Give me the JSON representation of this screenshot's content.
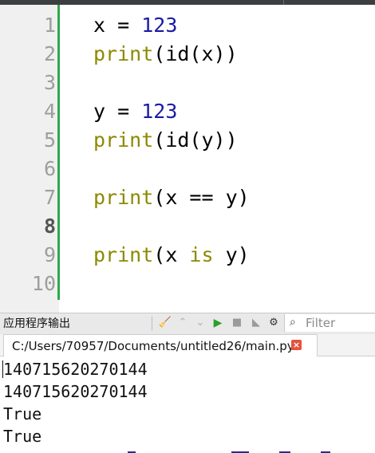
{
  "editor": {
    "line_numbers": [
      "1",
      "2",
      "3",
      "4",
      "5",
      "6",
      "7",
      "8",
      "9",
      "10"
    ],
    "active_line": "8",
    "lines": [
      {
        "tokens": [
          {
            "t": "x",
            "c": "var"
          },
          {
            "t": " = ",
            "c": "op"
          },
          {
            "t": "123",
            "c": "num"
          }
        ]
      },
      {
        "tokens": [
          {
            "t": "print",
            "c": "kw"
          },
          {
            "t": "(id(x))",
            "c": "op"
          }
        ]
      },
      {
        "tokens": []
      },
      {
        "tokens": [
          {
            "t": "y",
            "c": "var"
          },
          {
            "t": " = ",
            "c": "op"
          },
          {
            "t": "123",
            "c": "num"
          }
        ]
      },
      {
        "tokens": [
          {
            "t": "print",
            "c": "kw"
          },
          {
            "t": "(id(y))",
            "c": "op"
          }
        ]
      },
      {
        "tokens": []
      },
      {
        "tokens": [
          {
            "t": "print",
            "c": "kw"
          },
          {
            "t": "(x == y)",
            "c": "op"
          }
        ]
      },
      {
        "tokens": []
      },
      {
        "tokens": [
          {
            "t": "print",
            "c": "kw"
          },
          {
            "t": "(x ",
            "c": "op"
          },
          {
            "t": "is",
            "c": "kw"
          },
          {
            "t": " y)",
            "c": "op"
          }
        ]
      },
      {
        "tokens": []
      }
    ]
  },
  "panel": {
    "title": "应用程序输出",
    "filter_placeholder": "Filter"
  },
  "tab": {
    "label": "C:/Users/70957/Documents/untitled26/main.py",
    "close": "×"
  },
  "output": {
    "lines": [
      "140715620270144",
      "140715620270144",
      "True",
      "True"
    ]
  },
  "colors": {
    "keyword": "#8c8a00",
    "number": "#1a1aa6",
    "gutter_bar": "#2fa84f",
    "run": "#2aa12a"
  }
}
